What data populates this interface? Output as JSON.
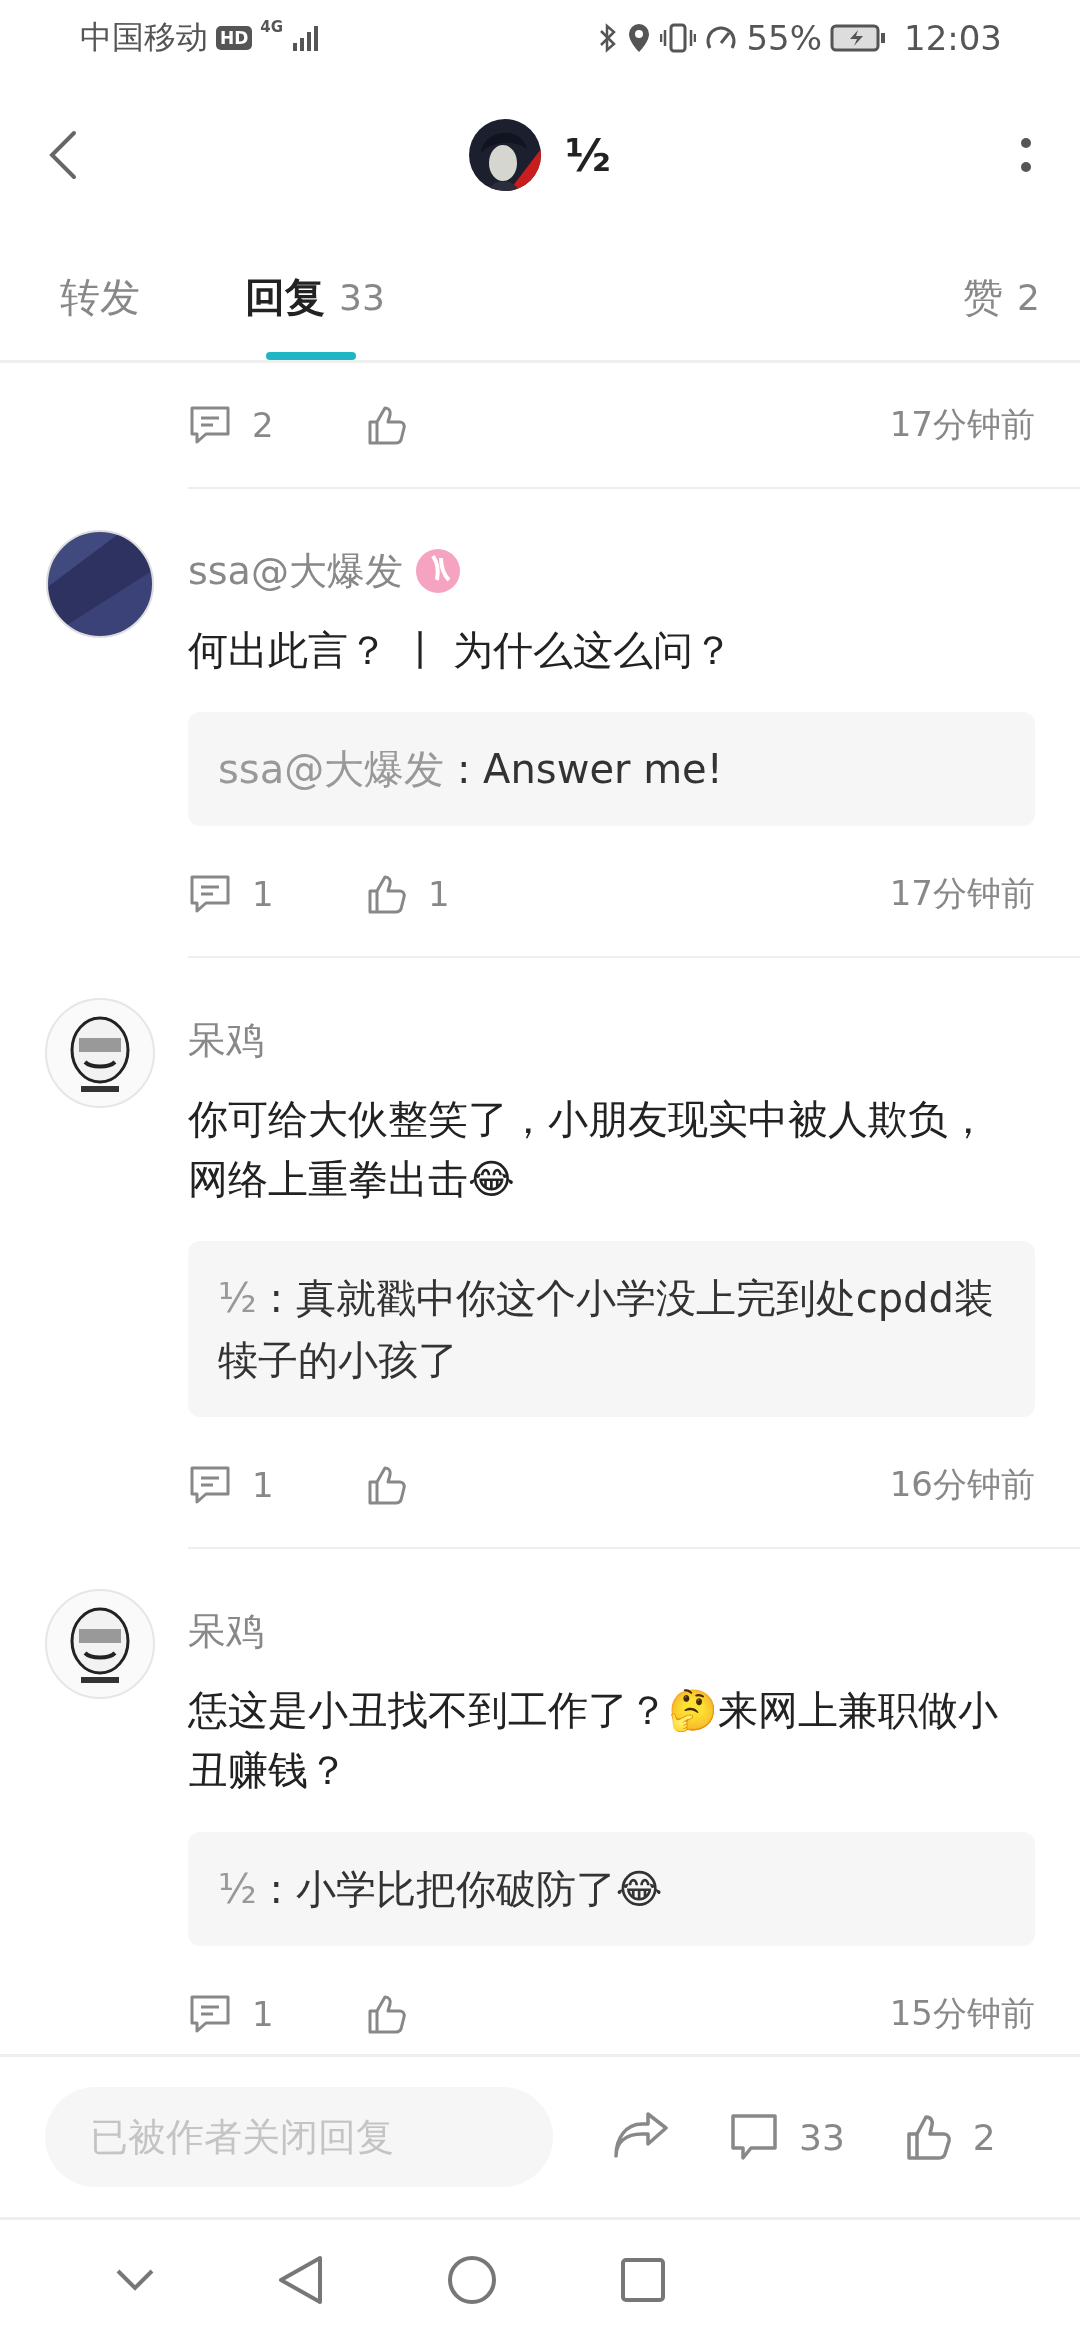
{
  "status_bar": {
    "carrier": "中国移动",
    "hd": "HD",
    "network": "4G",
    "battery": "55%",
    "time": "12:03"
  },
  "header": {
    "title": "½"
  },
  "tabs": [
    {
      "label": "转发",
      "selected": false
    },
    {
      "label": "回复",
      "count": "33",
      "selected": true
    },
    {
      "label": "赞",
      "count": "2",
      "selected": false
    }
  ],
  "comments": [
    {
      "reply_count": "2",
      "time": "17分钟前"
    },
    {
      "author": "ssa@大爆发",
      "avatar": {
        "kind": "disc"
      },
      "badge": true,
      "text": "何出此言？ 丨 为什么这么问？",
      "quote": {
        "author": "ssa@大爆发",
        "text": ": Answer me!"
      },
      "reply_count": "1",
      "like_count": "1",
      "time": "17分钟前"
    },
    {
      "author": "呆鸡",
      "avatar": {
        "kind": "figure"
      },
      "badge": false,
      "text": "你可给大伙整笑了，小朋友现实中被人欺负，网络上重拳出击😂",
      "quote": {
        "author": "½",
        "text": ": 真就戳中你这个小学没上完到处cpdd装犊子的小孩了"
      },
      "reply_count": "1",
      "time": "16分钟前"
    },
    {
      "author": "呆鸡",
      "avatar": {
        "kind": "figure"
      },
      "badge": false,
      "text": "恁这是小丑找不到工作了？🤔来网上兼职做小丑赚钱？",
      "quote": {
        "author": "½",
        "text": ": 小学比把你破防了😂"
      },
      "reply_count": "1",
      "time": "15分钟前"
    }
  ],
  "bottom_bar": {
    "placeholder": "已被作者关闭回复",
    "comment_count": "33",
    "like_count": "2"
  }
}
